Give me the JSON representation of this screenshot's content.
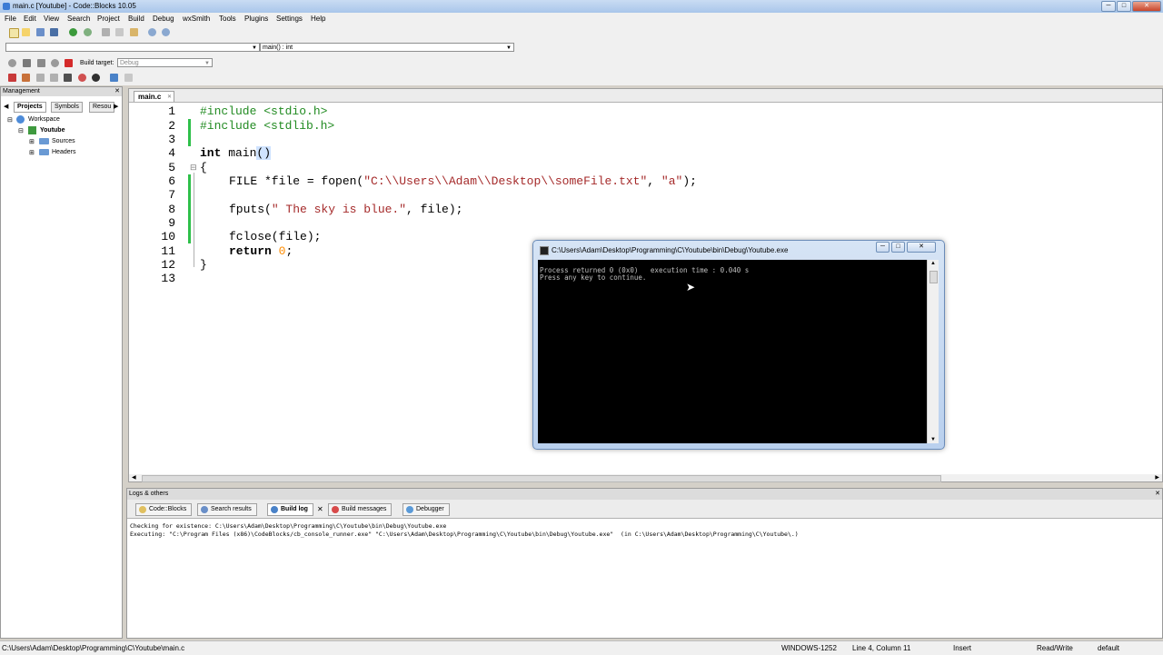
{
  "window": {
    "title": "main.c [Youtube] - Code::Blocks 10.05",
    "minimize": "─",
    "maximize": "□",
    "close": "✕"
  },
  "menu": [
    "File",
    "Edit",
    "View",
    "Search",
    "Project",
    "Build",
    "Debug",
    "wxSmith",
    "Tools",
    "Plugins",
    "Settings",
    "Help"
  ],
  "toolbar": {
    "scope_combo": "",
    "function_combo": "main() : int",
    "build_target_label": "Build target:",
    "build_target_value": "Debug"
  },
  "management": {
    "title": "Management",
    "close": "✕",
    "tabs": [
      "Projects",
      "Symbols",
      "Resou"
    ],
    "tree": {
      "workspace": "Workspace",
      "project": "Youtube",
      "sources": "Sources",
      "headers": "Headers"
    }
  },
  "editor": {
    "file_tab": "main.c",
    "file_tab_close": "✕",
    "line_numbers": [
      "1",
      "2",
      "3",
      "4",
      "5",
      "6",
      "7",
      "8",
      "9",
      "10",
      "11",
      "12",
      "13"
    ],
    "lines": {
      "l1": "#include <stdio.h>",
      "l2": "#include <stdlib.h>",
      "l4_kw": "int",
      "l4_rest": " main",
      "l4_paren": "()",
      "l5": "{",
      "l6_a": "FILE *file = fopen(",
      "l6_s1": "\"C:\\\\Users\\\\Adam\\\\Desktop\\\\someFile.txt\"",
      "l6_b": ", ",
      "l6_s2": "\"a\"",
      "l6_c": ");",
      "l8_a": "fputs(",
      "l8_s": "\" The sky is blue.\"",
      "l8_b": ", file);",
      "l10": "fclose(file);",
      "l11_kw": "return",
      "l11_num": "0",
      "l11_end": ";",
      "l12": "}"
    }
  },
  "console": {
    "title": "C:\\Users\\Adam\\Desktop\\Programming\\C\\Youtube\\bin\\Debug\\Youtube.exe",
    "line1": "Process returned 0 (0x0)   execution time : 0.040 s",
    "line2": "Press any key to continue."
  },
  "logs": {
    "title": "Logs & others",
    "close": "✕",
    "tabs": [
      "Code::Blocks",
      "Search results",
      "Build log",
      "Build messages",
      "Debugger"
    ],
    "active_tab": "Build log",
    "lines": [
      "Checking for existence: C:\\Users\\Adam\\Desktop\\Programming\\C\\Youtube\\bin\\Debug\\Youtube.exe",
      "Executing: \"C:\\Program Files (x86)\\CodeBlocks/cb_console_runner.exe\" \"C:\\Users\\Adam\\Desktop\\Programming\\C\\Youtube\\bin\\Debug\\Youtube.exe\"  (in C:\\Users\\Adam\\Desktop\\Programming\\C\\Youtube\\.)"
    ]
  },
  "status": {
    "path": "C:\\Users\\Adam\\Desktop\\Programming\\C\\Youtube\\main.c",
    "encoding": "WINDOWS-1252",
    "position": "Line 4, Column 11",
    "mode": "Insert",
    "access": "Read/Write",
    "theme": "default"
  },
  "colors": {
    "accent": "#3a7bd5",
    "green_marker": "#2ec04a",
    "string": "#a52a2a",
    "preproc": "#228b22",
    "number": "#ff8c00"
  }
}
